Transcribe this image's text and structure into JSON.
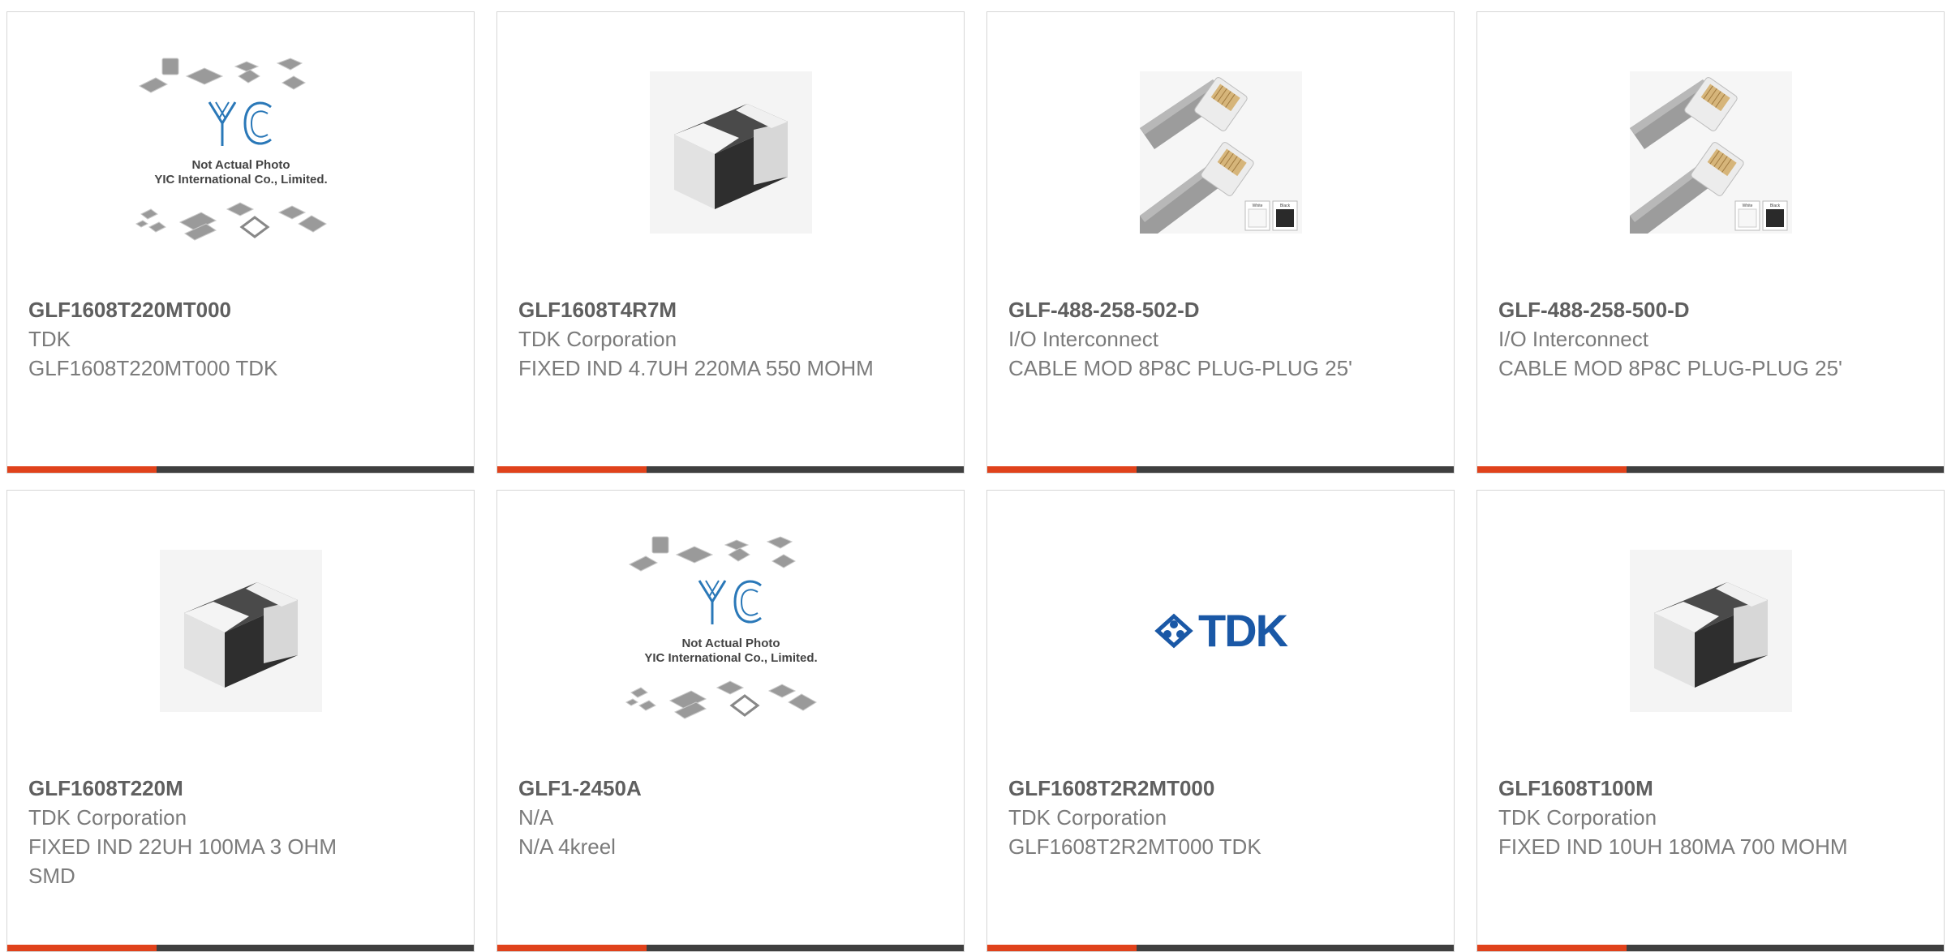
{
  "colors": {
    "accent": "#e0421b",
    "bar_dark": "#3f3f3f",
    "tdk_blue": "#1a58a6",
    "yic_blue": "#2a78b8"
  },
  "products": [
    {
      "part": "GLF1608T220MT000",
      "manufacturer": "TDK",
      "description": "GLF1608T220MT000 TDK",
      "image": "yic-placeholder",
      "image_caption_1": "Not Actual Photo",
      "image_caption_2": "YIC International Co., Limited."
    },
    {
      "part": "GLF1608T4R7M",
      "manufacturer": "TDK Corporation",
      "description": "FIXED IND 4.7UH 220MA 550 MOHM",
      "image": "smd-inductor"
    },
    {
      "part": "GLF-488-258-502-D",
      "manufacturer": "I/O Interconnect",
      "description": "CABLE MOD 8P8C PLUG-PLUG 25'",
      "image": "modular-cable",
      "image_caption_1": "White",
      "image_caption_2": "Black"
    },
    {
      "part": "GLF-488-258-500-D",
      "manufacturer": "I/O Interconnect",
      "description": "CABLE MOD 8P8C PLUG-PLUG 25'",
      "image": "modular-cable",
      "image_caption_1": "White",
      "image_caption_2": "Black"
    },
    {
      "part": "GLF1608T220M",
      "manufacturer": "TDK Corporation",
      "description": "FIXED IND 22UH 100MA 3 OHM SMD",
      "image": "smd-inductor"
    },
    {
      "part": "GLF1-2450A",
      "manufacturer": "N/A",
      "description": "N/A 4kreel",
      "image": "yic-placeholder",
      "image_caption_1": "Not Actual Photo",
      "image_caption_2": "YIC International Co., Limited."
    },
    {
      "part": "GLF1608T2R2MT000",
      "manufacturer": "TDK Corporation",
      "description": "GLF1608T2R2MT000 TDK",
      "image": "tdk-logo",
      "image_caption_1": "TDK"
    },
    {
      "part": "GLF1608T100M",
      "manufacturer": "TDK Corporation",
      "description": "FIXED IND 10UH 180MA 700 MOHM",
      "image": "smd-inductor"
    }
  ]
}
